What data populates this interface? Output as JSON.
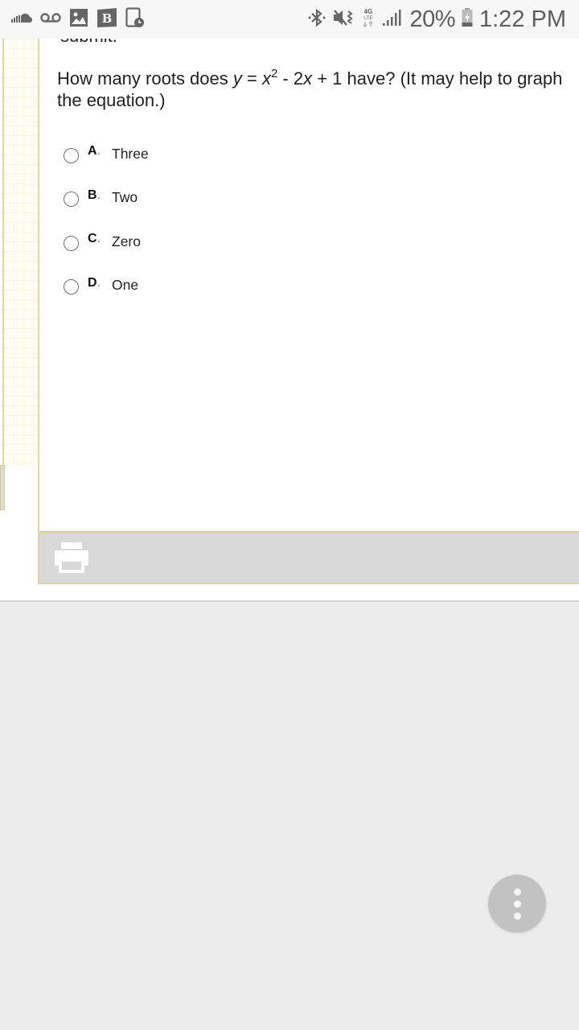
{
  "status_bar": {
    "left_icons": [
      "soundcloud-icon",
      "voicemail-icon",
      "gallery-icon",
      "bold-app-icon",
      "tablet-clock-icon"
    ],
    "right_icons": [
      "bluetooth-icon",
      "vibrate-mute-icon",
      "4g-lte-icon",
      "signal-icon"
    ],
    "network_label_top": "4G",
    "network_label_bottom": "LTE",
    "battery_percent": "20%",
    "time": "1:22 PM"
  },
  "quiz": {
    "cut_off_text": "submit.",
    "question": {
      "prefix": "How many roots does ",
      "var_y": "y",
      "equals": " = ",
      "var_x": "x",
      "exponent": "2",
      "middle": " - 2",
      "var_x2": "x",
      "suffix": " + 1 have? (It may help to graph the equation.)"
    },
    "options": [
      {
        "letter": "A",
        "text": "Three",
        "selected": false
      },
      {
        "letter": "B",
        "text": "Two",
        "selected": false
      },
      {
        "letter": "C",
        "text": "Zero",
        "selected": false
      },
      {
        "letter": "D",
        "text": "One",
        "selected": false
      }
    ],
    "letter_separator": "."
  },
  "footer": {
    "print_icon": "printer-icon"
  },
  "fab": {
    "icon": "more-vertical-icon"
  },
  "colors": {
    "card_border": "#e6d4a0",
    "footer_bg": "#d8d8d8",
    "fab_bg": "#c2c2c2",
    "page_bg": "#ececec"
  }
}
